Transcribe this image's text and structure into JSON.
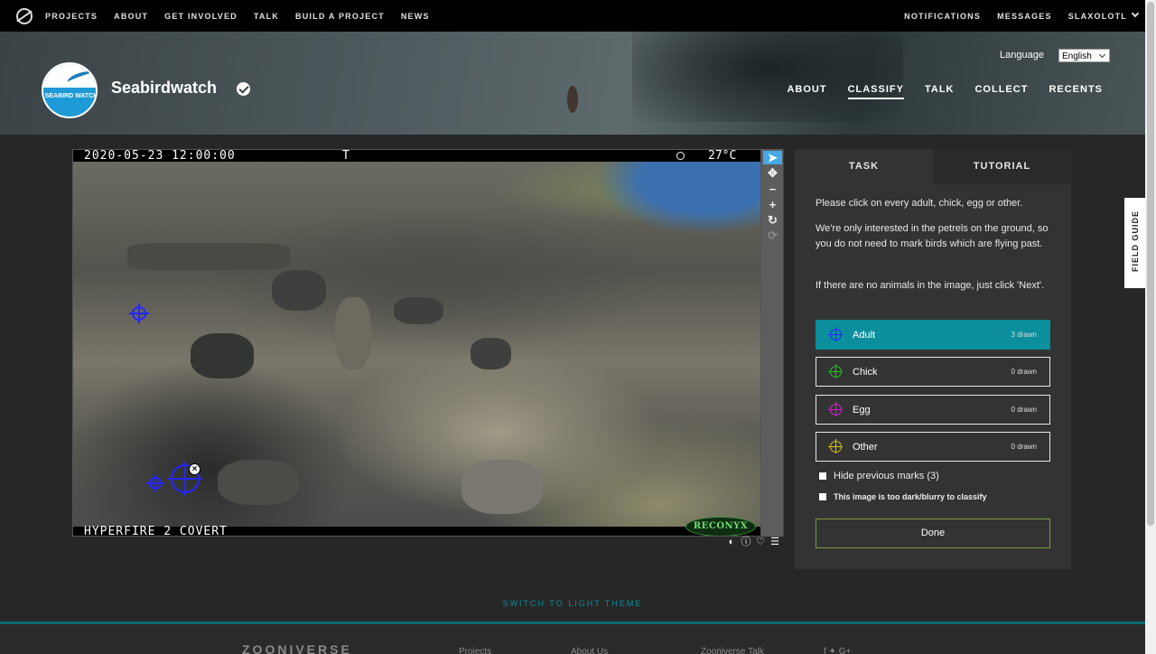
{
  "topbar": {
    "nav": [
      "PROJECTS",
      "ABOUT",
      "GET INVOLVED",
      "TALK",
      "BUILD A PROJECT",
      "NEWS"
    ],
    "notifications": "NOTIFICATIONS",
    "messages": "MESSAGES",
    "user": "SLAXOLOTL"
  },
  "project": {
    "title": "Seabirdwatch",
    "logo_text": "SEABIRD WATCH",
    "language_label": "Language",
    "language_value": "English",
    "nav": [
      "ABOUT",
      "CLASSIFY",
      "TALK",
      "COLLECT",
      "RECENTS"
    ],
    "active_nav": "CLASSIFY"
  },
  "subject": {
    "timestamp": "2020-05-23 12:00:00",
    "t_marker": "T",
    "temperature": "27°C",
    "camera": "HYPERFIRE 2 COVERT",
    "brand": "RECONYX"
  },
  "task": {
    "tabs": [
      "TASK",
      "TUTORIAL"
    ],
    "instructions": [
      "Please click on every adult, chick, egg or other.",
      "We're only interested in the petrels on the ground, so you do not need to mark birds which are flying past.",
      "If there are no animals in the image, just click 'Next'."
    ],
    "tools": [
      {
        "name": "Adult",
        "count": "3 drawn",
        "color": "#2525ff"
      },
      {
        "name": "Chick",
        "count": "0 drawn",
        "color": "#21c021"
      },
      {
        "name": "Egg",
        "count": "0 drawn",
        "color": "#d020d0"
      },
      {
        "name": "Other",
        "count": "0 drawn",
        "color": "#d4c21a"
      }
    ],
    "hide_marks": "Hide previous marks (3)",
    "too_dark": "This image is too dark/blurry to classify",
    "done": "Done"
  },
  "field_guide": "FIELD GUIDE",
  "theme_switch": "SWITCH TO LIGHT THEME",
  "footer": {
    "logo": "ZOONIVERSE",
    "links": [
      "Projects",
      "About Us",
      "Zooniverse Talk"
    ]
  },
  "colors": {
    "accent": "#0b8f9c",
    "mark": "#2525ff"
  }
}
